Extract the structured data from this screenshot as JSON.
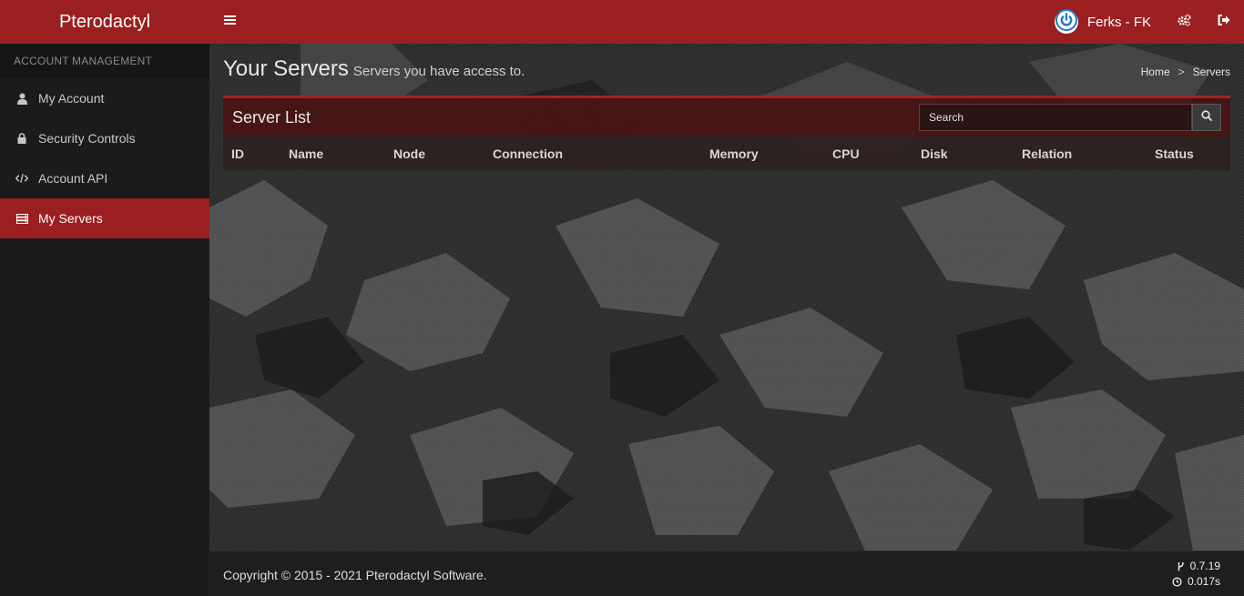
{
  "app": {
    "brand": "Pterodactyl"
  },
  "header": {
    "user_name": "Ferks - FK"
  },
  "sidebar": {
    "section_label": "ACCOUNT MANAGEMENT",
    "items": [
      {
        "label": "My Account",
        "icon": "user-icon",
        "active": false
      },
      {
        "label": "Security Controls",
        "icon": "lock-icon",
        "active": false
      },
      {
        "label": "Account API",
        "icon": "code-icon",
        "active": false
      },
      {
        "label": "My Servers",
        "icon": "server-icon",
        "active": true
      }
    ]
  },
  "page": {
    "title": "Your Servers",
    "subtitle": "Servers you have access to.",
    "breadcrumb": [
      "Home",
      "Servers"
    ],
    "breadcrumb_sep": ">"
  },
  "server_list": {
    "title": "Server List",
    "search_placeholder": "Search",
    "columns": [
      "ID",
      "Name",
      "Node",
      "Connection",
      "Memory",
      "CPU",
      "Disk",
      "Relation",
      "Status"
    ],
    "rows": []
  },
  "footer": {
    "copyright": "Copyright © 2015 - 2021 Pterodactyl Software.",
    "version": "0.7.19",
    "render_time": "0.017s"
  },
  "colors": {
    "accent": "#9b1f20",
    "sidebar_bg": "#1b1b1b"
  }
}
